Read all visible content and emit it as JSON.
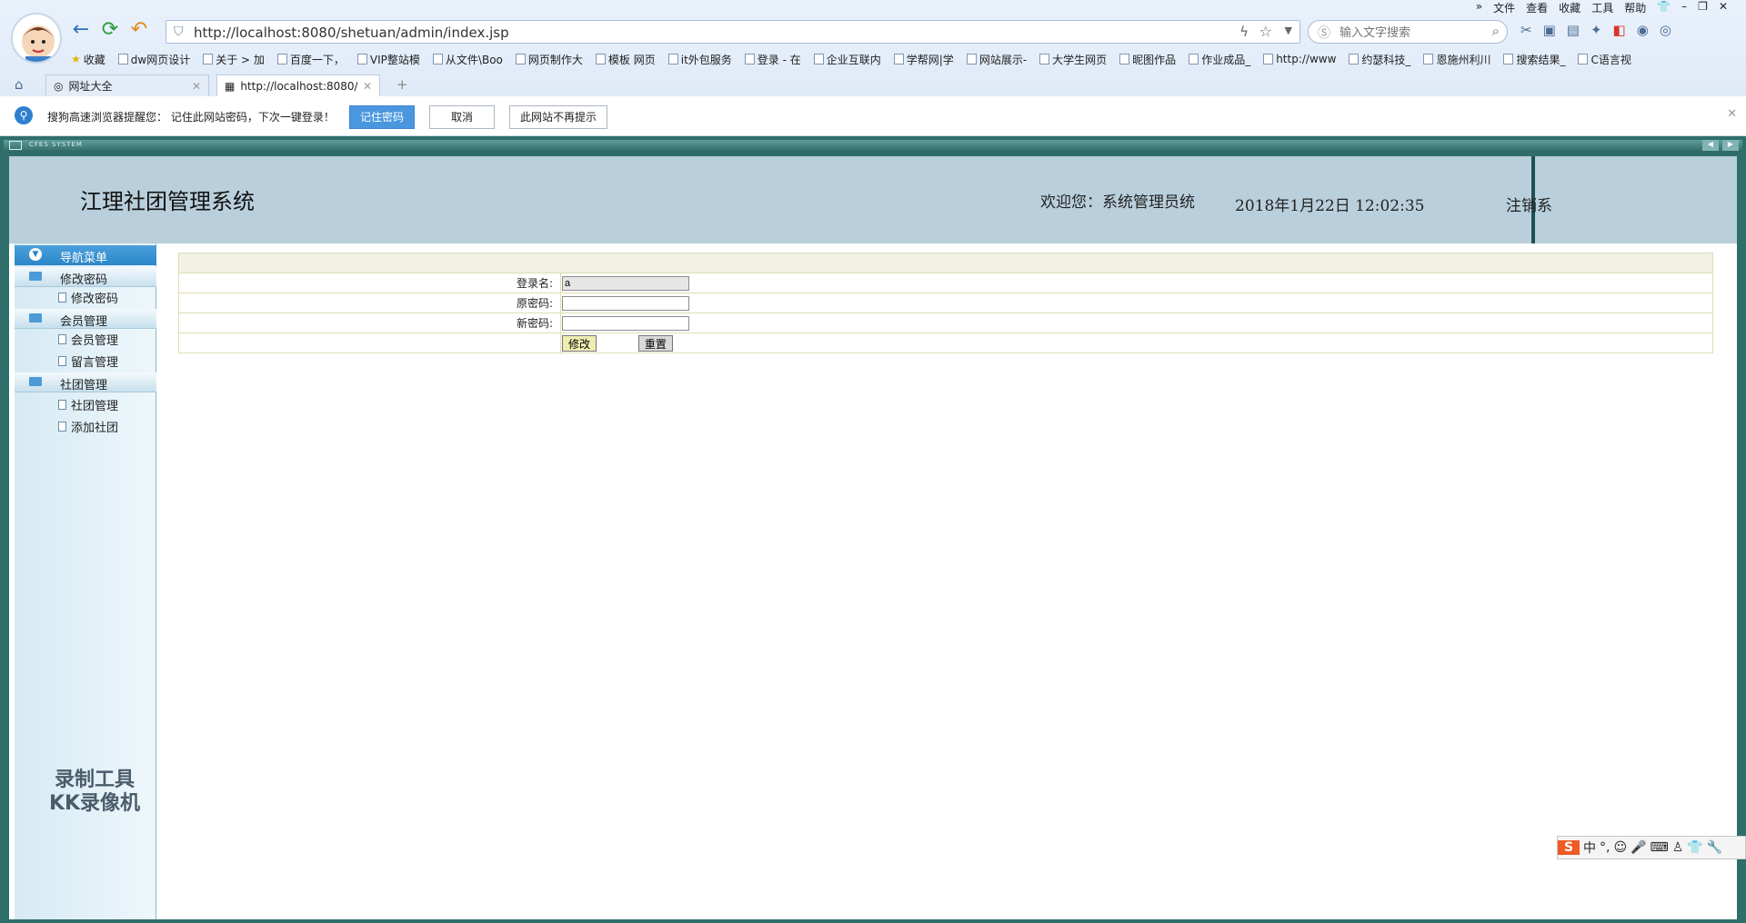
{
  "browser": {
    "url": "http://localhost:8080/shetuan/admin/index.jsp",
    "search_placeholder": "输入文字搜索",
    "menu": [
      "文件",
      "查看",
      "收藏",
      "工具",
      "帮助"
    ],
    "bookmarks_label": "收藏",
    "bookmarks": [
      "dw网页设计",
      "关于 > 加",
      "百度一下，",
      "VIP整站模",
      "从文件\\Boo",
      "网页制作大",
      "模板 网页",
      "it外包服务",
      "登录 - 在",
      "企业互联内",
      "学帮网|学",
      "网站展示-",
      "大学生网页",
      "昵图作品",
      "作业成品_",
      "http://www",
      "约瑟科技_",
      "恩施州利川",
      "搜索结果_",
      "C语言视"
    ],
    "tabs": [
      {
        "label": "网址大全"
      },
      {
        "label": "http://localhost:8080/"
      }
    ],
    "new_tab": "+",
    "infobar": {
      "message": "搜狗高速浏览器提醒您： 记住此网站密码，下次一键登录！",
      "remember": "记住密码",
      "cancel": "取消",
      "never": "此网站不再提示"
    }
  },
  "app": {
    "frame_title": "CFES SYSTEM",
    "system_title": "江理社团管理系统",
    "welcome": "欢迎您：系统管理员统",
    "datetime": "2018年1月22日 12:02:35",
    "logout": "注销系",
    "nav_header": "导航菜单",
    "groups": [
      {
        "label": "修改密码",
        "items": [
          "修改密码"
        ]
      },
      {
        "label": "会员管理",
        "items": [
          "会员管理",
          "留言管理"
        ]
      },
      {
        "label": "社团管理",
        "items": [
          "社团管理",
          "添加社团"
        ]
      }
    ],
    "watermark_line1": "录制工具",
    "watermark_line2": "KK录像机"
  },
  "form": {
    "login_label": "登录名:",
    "login_value": "a",
    "old_pwd_label": "原密码:",
    "new_pwd_label": "新密码:",
    "submit": "修改",
    "reset": "重置"
  },
  "ime": {
    "label": "中"
  }
}
